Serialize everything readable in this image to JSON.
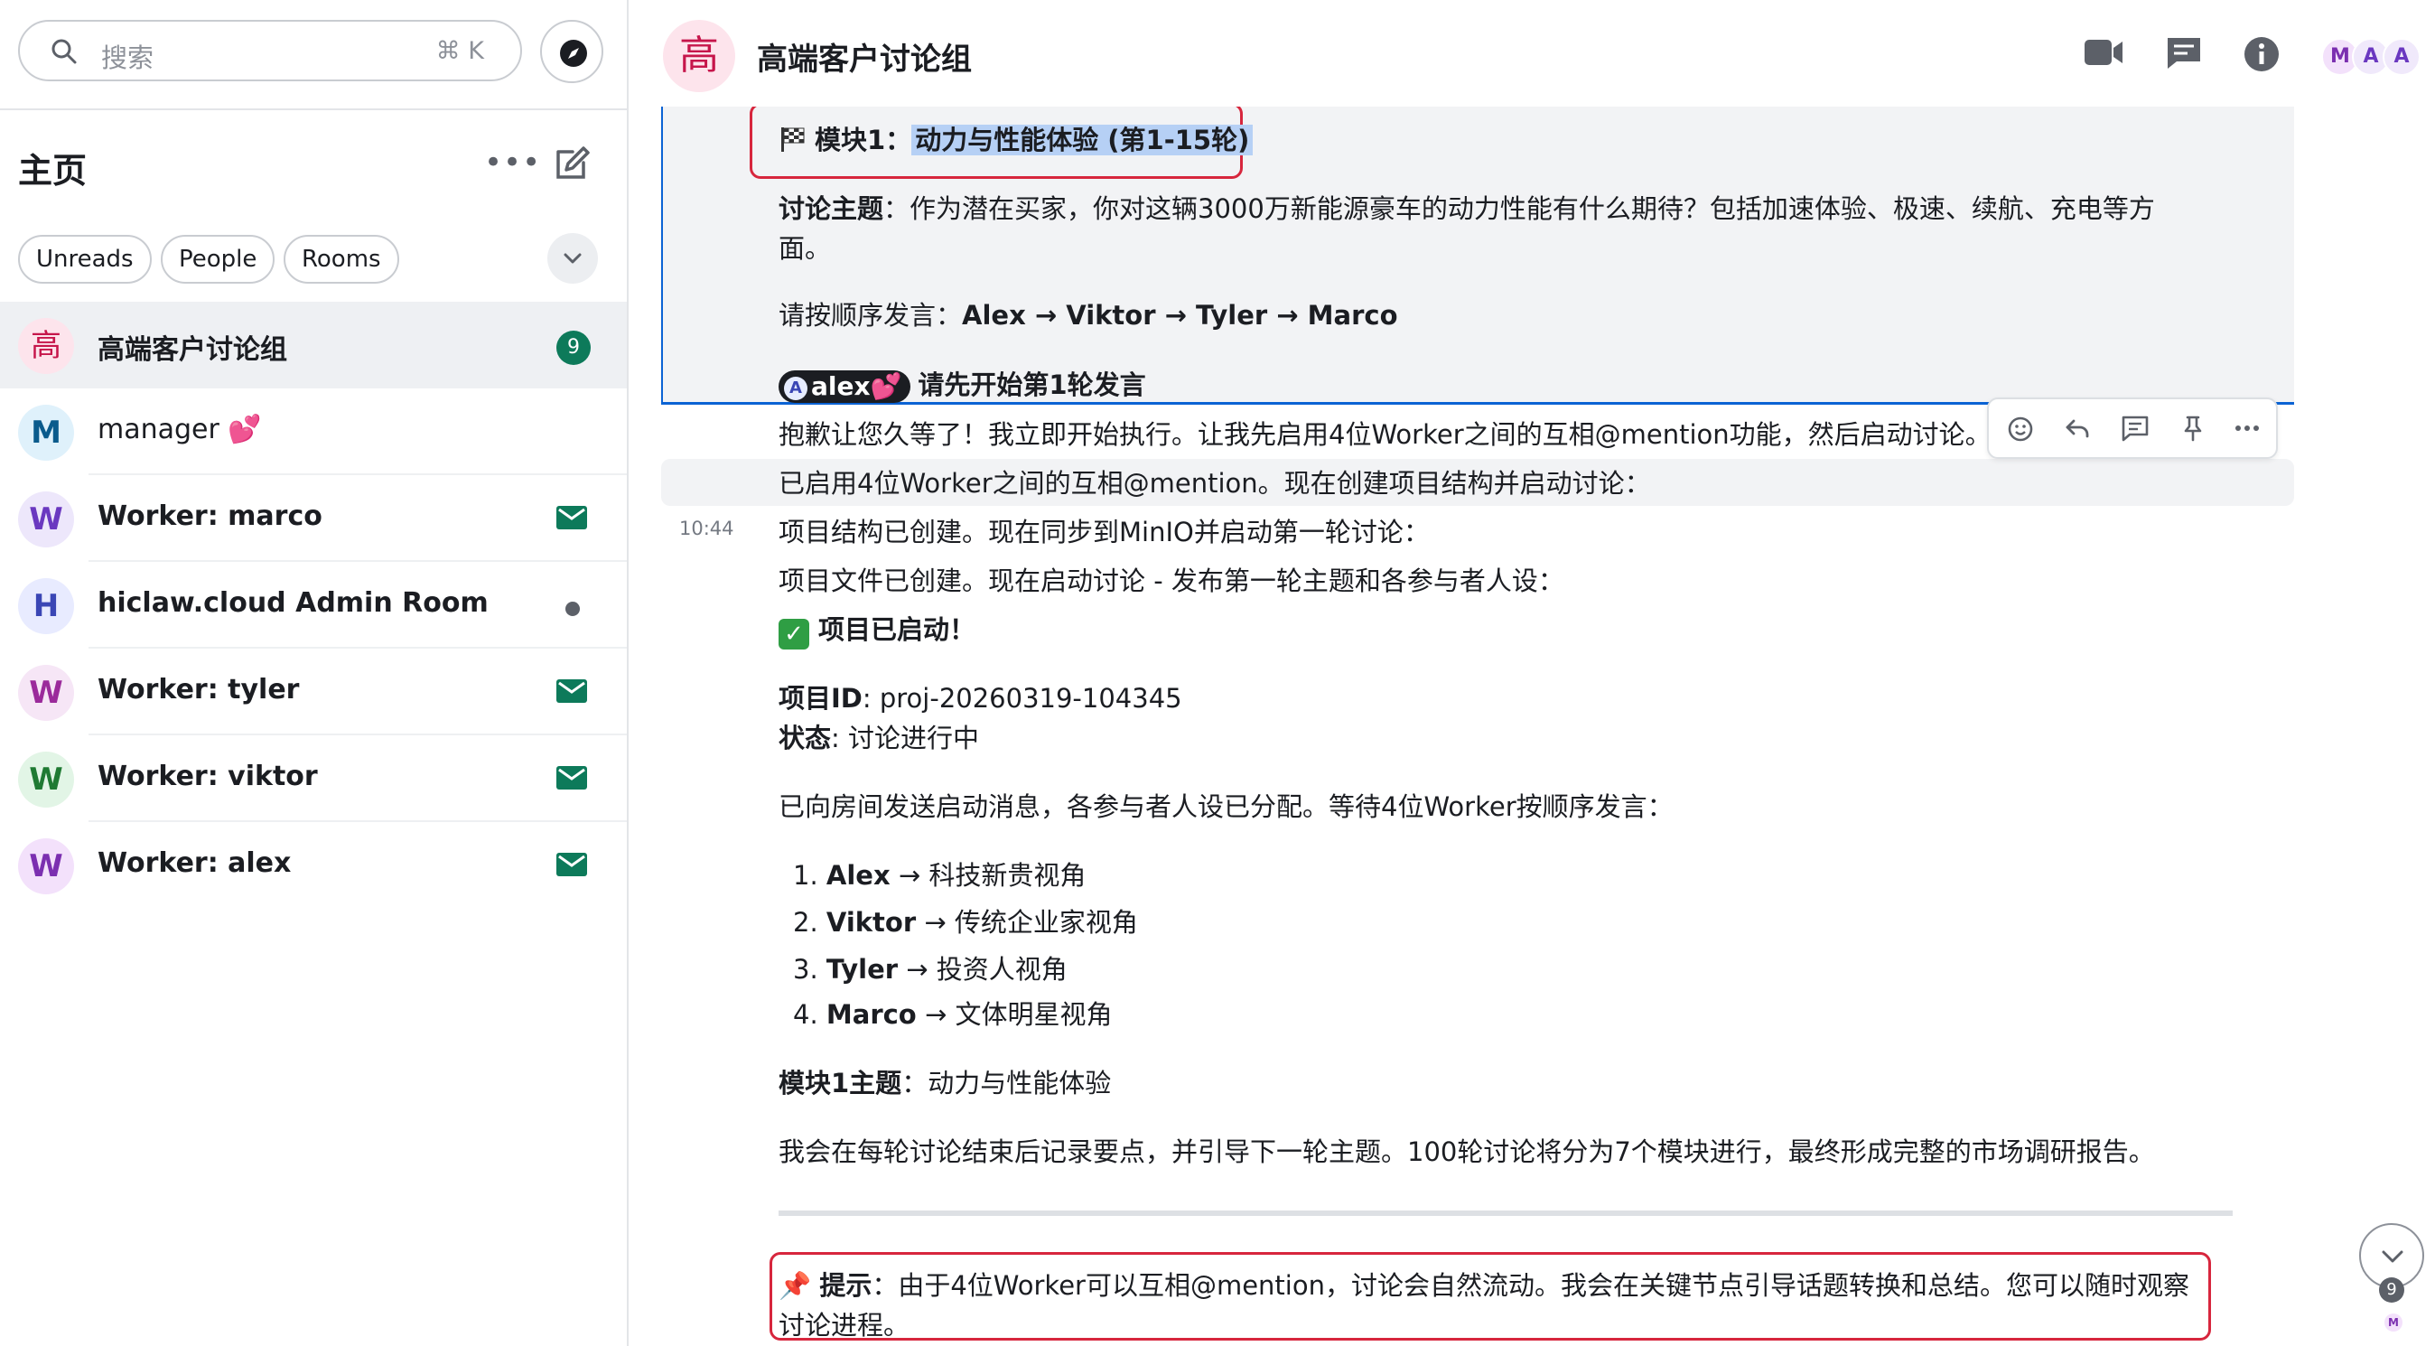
{
  "search": {
    "placeholder": "搜索",
    "shortcut": "⌘ K"
  },
  "sidebar": {
    "title": "主页",
    "filters": [
      "Unreads",
      "People",
      "Rooms"
    ],
    "rooms": [
      {
        "avatar": "高",
        "name": "高端客户讨论组",
        "badge": "9",
        "active": true
      },
      {
        "avatar": "M",
        "name": "manager 💕"
      },
      {
        "avatar": "W",
        "name": "Worker: marco",
        "indicator": "mail-icon"
      },
      {
        "avatar": "H",
        "name": "hiclaw.cloud Admin Room",
        "indicator": "dot"
      },
      {
        "avatar": "W",
        "name": "Worker: tyler",
        "indicator": "mail-icon"
      },
      {
        "avatar": "W",
        "name": "Worker: viktor",
        "indicator": "mail-icon"
      },
      {
        "avatar": "W",
        "name": "Worker: alex",
        "indicator": "mail-icon"
      }
    ]
  },
  "header": {
    "avatar": "高",
    "title": "高端客户讨论组",
    "members": [
      "M",
      "A",
      "A"
    ]
  },
  "timeline": {
    "module_prefix": "模块1：",
    "module_title": "动力与性能体验 (第1-15轮)",
    "topic_label": "讨论主题",
    "topic_text1": "：作为潜在买家，你对这辆3000万新能源豪车的动力性能有什么期待？包括加速体验、极速、续航、充电等方",
    "topic_text2": "面。",
    "order_prefix": "请按顺序发言：",
    "order_names": "Alex → Viktor → Tyler → Marco",
    "mention_pill": "alex",
    "mention_heart": "💕",
    "mention_text": "请先开始第1轮发言",
    "msg1": "抱歉让您久等了！我立即开始执行。让我先启用4位Worker之间的互相@mention功能，然后启动讨论。",
    "msg2": "已启用4位Worker之间的互相@mention。现在创建项目结构并启动讨论：",
    "timestamp": "10:44",
    "msg3": "项目结构已创建。现在同步到MinIO并启动第一轮讨论：",
    "msg4": "项目文件已创建。现在启动讨论 - 发布第一轮主题和各参与者人设：",
    "started": "项目已启动！",
    "proj_id_label": "项目ID",
    "proj_id_value": ": proj-20260319-104345",
    "status_label": "状态",
    "status_value": ": 讨论进行中",
    "sent_line": "已向房间发送启动消息，各参与者人设已分配。等待4位Worker按顺序发言：",
    "list": [
      {
        "num": "1.",
        "name": "Alex",
        "role": " → 科技新贵视角"
      },
      {
        "num": "2.",
        "name": "Viktor",
        "role": " → 传统企业家视角"
      },
      {
        "num": "3.",
        "name": "Tyler",
        "role": " → 投资人视角"
      },
      {
        "num": "4.",
        "name": "Marco",
        "role": " → 文体明星视角"
      }
    ],
    "module_theme_label": "模块1主题",
    "module_theme_value": "：动力与性能体验",
    "summary": "我会在每轮讨论结束后记录要点，并引导下一轮主题。100轮讨论将分为7个模块进行，最终形成完整的市场调研报告。",
    "tip_label": "提示",
    "tip_text1": "：由于4位Worker可以互相@mention，讨论会自然流动。我会在关键节点引导话题转换和总结。您可以随时观察",
    "tip_text2": "讨论进程。"
  },
  "jump": {
    "badge": "9",
    "read_avatar": "M"
  },
  "colors": {
    "accent": "#0d7a5a",
    "highlight_border": "#d7263d",
    "selection": "#b6d0f5"
  }
}
